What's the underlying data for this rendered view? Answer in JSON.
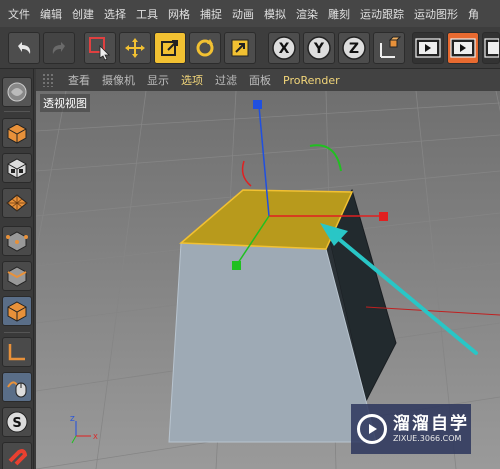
{
  "menu": [
    "文件",
    "编辑",
    "创建",
    "选择",
    "工具",
    "网格",
    "捕捉",
    "动画",
    "模拟",
    "渲染",
    "雕刻",
    "运动跟踪",
    "运动图形",
    "角"
  ],
  "viewport_menu": [
    "查看",
    "摄像机",
    "显示",
    "选项",
    "过滤",
    "面板",
    "ProRender"
  ],
  "viewport_label": "透视视图",
  "axis_buttons": {
    "x": "X",
    "y": "Y",
    "z": "Z"
  },
  "watermark": {
    "title": "溜溜自学",
    "url": "ZIXUE.3066.COM"
  },
  "colors": {
    "accent": "#f2c132",
    "selected_face": "#b89a1c",
    "x_axis": "#e02020",
    "y_axis": "#20c020",
    "z_axis": "#2050e0",
    "arrow": "#29c6c6",
    "viewport_bg": "#8e8e8e"
  },
  "icons": [
    "undo-icon",
    "redo-icon",
    "live-selection-icon",
    "move-icon",
    "scale-icon",
    "rotate-icon",
    "recent-tool-icon",
    "x-lock-icon",
    "y-lock-icon",
    "z-lock-icon",
    "coordinate-system-icon",
    "render-view-icon",
    "render-picture-queue-icon",
    "render-settings-icon"
  ]
}
